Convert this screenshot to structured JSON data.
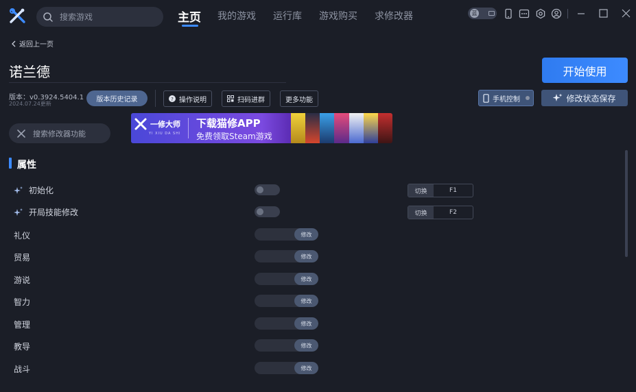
{
  "topbar": {
    "search_placeholder": "搜索游戏",
    "tabs": [
      {
        "label": "主页",
        "active": true
      },
      {
        "label": "我的游戏",
        "active": false
      },
      {
        "label": "运行库",
        "active": false
      },
      {
        "label": "游戏购买",
        "active": false
      },
      {
        "label": "求修改器",
        "active": false
      }
    ],
    "theme_toggle_glyph": "蓝",
    "icons": [
      "phone-icon",
      "message-icon",
      "settings-icon",
      "user-icon",
      "minimize-icon",
      "maximize-icon",
      "close-icon"
    ]
  },
  "header": {
    "back_label": "返回上一页",
    "game_title": "诺兰德",
    "start_button": "开始使用",
    "version": "版本：v0.3924.5404.1",
    "version_date": "2024.07.24更新",
    "history_button": "版本历史记录",
    "help_button": "操作说明",
    "qr_button": "扫码进群",
    "more_button": "更多功能",
    "mobile_button": "手机控制",
    "save_button": "修改状态保存"
  },
  "function_search_placeholder": "搜索修改器功能",
  "banner": {
    "brand_name": "一修大师",
    "brand_sub": "YI XIU DA SHI",
    "headline": "下载猫修APP",
    "subline": "免费领取Steam游戏"
  },
  "section": {
    "title": "属性",
    "accent_color": "#3d8bff",
    "toggles": [
      {
        "label": "初始化",
        "mode": "切换",
        "key": "F1",
        "on": false
      },
      {
        "label": "开局技能修改",
        "mode": "切换",
        "key": "F2",
        "on": false
      }
    ],
    "editable_label": "修改",
    "stats": [
      {
        "label": "礼仪",
        "value": ""
      },
      {
        "label": "贸易",
        "value": ""
      },
      {
        "label": "游说",
        "value": ""
      },
      {
        "label": "智力",
        "value": ""
      },
      {
        "label": "管理",
        "value": ""
      },
      {
        "label": "教导",
        "value": ""
      },
      {
        "label": "战斗",
        "value": ""
      }
    ]
  }
}
